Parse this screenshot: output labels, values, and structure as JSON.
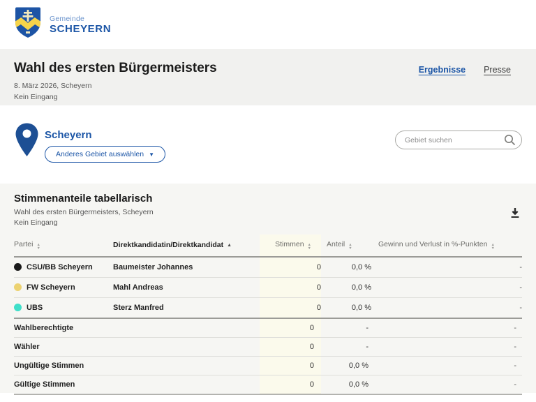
{
  "brand": {
    "org": "Gemeinde",
    "name": "SCHEYERN"
  },
  "title_band": {
    "title": "Wahl des ersten Bürgermeisters",
    "date_line": "8. März 2026, Scheyern",
    "status_line": "Kein Eingang",
    "nav": [
      {
        "label": "Ergebnisse",
        "active": true
      },
      {
        "label": "Presse",
        "active": false
      }
    ]
  },
  "area": {
    "name": "Scheyern",
    "change_button_label": "Anderes Gebiet auswählen",
    "search_placeholder": "Gebiet suchen"
  },
  "table_section": {
    "title": "Stimmenanteile tabellarisch",
    "subtitle": "Wahl des ersten Bürgermeisters, Scheyern",
    "status": "Kein Eingang"
  },
  "table": {
    "columns": [
      "Partei",
      "Direktkandidatin/Direktkandidat",
      "Stimmen",
      "Anteil",
      "Gewinn und Verlust in %-Punkten"
    ],
    "sorted_column": "Direktkandidatin/Direktkandidat",
    "sort_direction": "ascending",
    "party_rows": [
      {
        "party": "CSU/BB Scheyern",
        "color": "#1a1a1a",
        "candidate": "Baumeister Johannes",
        "stimmen": "0",
        "anteil": "0,0 %",
        "gewinn": "-"
      },
      {
        "party": "FW Scheyern",
        "color": "#ecd271",
        "candidate": "Mahl Andreas",
        "stimmen": "0",
        "anteil": "0,0 %",
        "gewinn": "-"
      },
      {
        "party": "UBS",
        "color": "#3fdfc9",
        "candidate": "Sterz Manfred",
        "stimmen": "0",
        "anteil": "0,0 %",
        "gewinn": "-"
      }
    ],
    "stat_rows": [
      {
        "label": "Wahlberechtigte",
        "stimmen": "0",
        "anteil": "-",
        "gewinn": "-"
      },
      {
        "label": "Wähler",
        "stimmen": "0",
        "anteil": "-",
        "gewinn": "-"
      },
      {
        "label": "Ungültige Stimmen",
        "stimmen": "0",
        "anteil": "0,0 %",
        "gewinn": "-"
      },
      {
        "label": "Gültige Stimmen",
        "stimmen": "0",
        "anteil": "0,0 %",
        "gewinn": "-"
      }
    ]
  },
  "colors": {
    "accent_blue": "#1b55a6",
    "band_bg": "#f1f1ef",
    "card_bg": "#f6f6f3",
    "stimmen_col_bg": "#fbfaec"
  }
}
